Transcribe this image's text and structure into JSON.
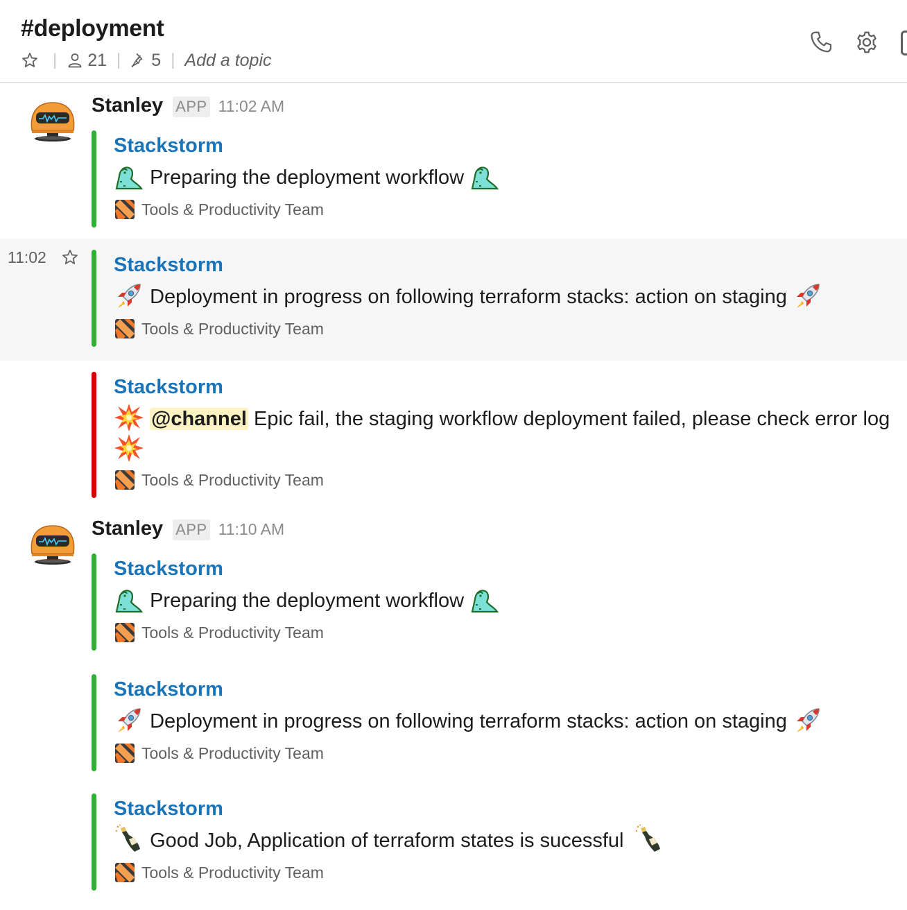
{
  "header": {
    "channel_name": "#deployment",
    "member_count": "21",
    "pinned_count": "5",
    "topic_placeholder": "Add a topic",
    "separator": "|"
  },
  "icons": {
    "star": "star-icon",
    "members": "person-icon",
    "pins": "pin-icon",
    "call": "phone-icon",
    "settings": "gear-icon",
    "rocket": "rocket-emoji",
    "collision": "collision-emoji",
    "champagne": "champagne-emoji",
    "dinosaur": "sauropod-emoji"
  },
  "colors": {
    "link_blue": "#1a74b8",
    "success_green": "#2eb134",
    "error_red": "#d40000",
    "mention_bg": "#fdf3c2",
    "avatar_orange": "#f29d38"
  },
  "groups": [
    {
      "sender": "Stanley",
      "badge": "APP",
      "time": "11:02 AM"
    },
    {
      "sender": "Stanley",
      "badge": "APP",
      "time": "11:10 AM"
    }
  ],
  "hover": {
    "time": "11:02"
  },
  "attachments": [
    {
      "title": "Stackstorm",
      "text": "Preparing the deployment workflow",
      "footer": "Tools & Productivity Team",
      "status": "success"
    },
    {
      "title": "Stackstorm",
      "text": "Deployment in progress on following terraform stacks: action on staging",
      "footer": "Tools & Productivity Team",
      "status": "success"
    },
    {
      "title": "Stackstorm",
      "mention": "@channel",
      "text": "Epic fail, the staging workflow deployment failed, please check error log",
      "footer": "Tools & Productivity Team",
      "status": "error"
    },
    {
      "title": "Stackstorm",
      "text": "Preparing the deployment workflow",
      "footer": "Tools & Productivity Team",
      "status": "success"
    },
    {
      "title": "Stackstorm",
      "text": "Deployment in progress on following terraform stacks: action on staging",
      "footer": "Tools & Productivity Team",
      "status": "success"
    },
    {
      "title": "Stackstorm",
      "text": "Good Job, Application of terraform states is sucessful",
      "footer": "Tools & Productivity Team",
      "status": "success"
    }
  ]
}
